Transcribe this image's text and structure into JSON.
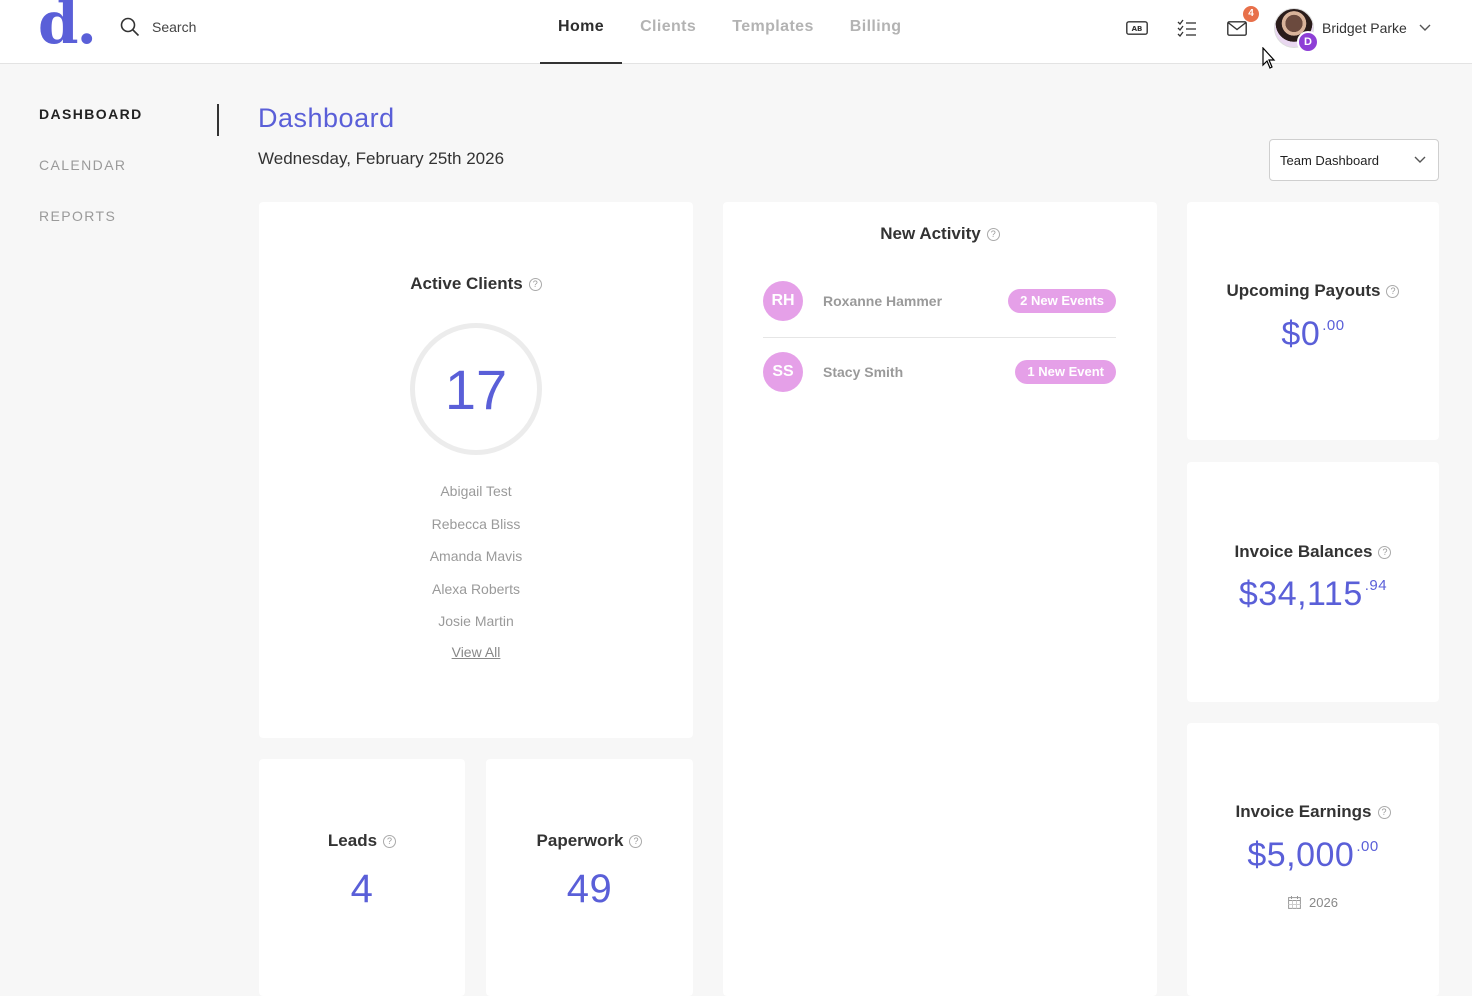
{
  "brand": {
    "logo_letter": "d",
    "logo_dot": "."
  },
  "search": {
    "label": "Search"
  },
  "nav": {
    "home": "Home",
    "clients": "Clients",
    "templates": "Templates",
    "billing": "Billing"
  },
  "header": {
    "mail_badge": "4",
    "user_name": "Bridget Parke",
    "user_avatar_initial": "D",
    "ab_icon_text": "AB"
  },
  "sidebar": {
    "items": [
      "DASHBOARD",
      "CALENDAR",
      "REPORTS"
    ]
  },
  "page": {
    "title": "Dashboard",
    "date": "Wednesday, February 25th 2026",
    "dashboard_select": "Team Dashboard"
  },
  "active_clients": {
    "title": "Active Clients",
    "count": "17",
    "clients": [
      "Abigail Test",
      "Rebecca Bliss",
      "Amanda Mavis",
      "Alexa Roberts",
      "Josie Martin"
    ],
    "view_all": "View All"
  },
  "new_activity": {
    "title": "New Activity",
    "rows": [
      {
        "initials": "RH",
        "name": "Roxanne Hammer",
        "events": "2 New Events"
      },
      {
        "initials": "SS",
        "name": "Stacy Smith",
        "events": "1 New Event"
      }
    ]
  },
  "leads": {
    "title": "Leads",
    "value": "4"
  },
  "paperwork": {
    "title": "Paperwork",
    "value": "49"
  },
  "upcoming_payouts": {
    "title": "Upcoming Payouts",
    "whole": "$0",
    "cents": ".00"
  },
  "invoice_balances": {
    "title": "Invoice Balances",
    "whole": "$34,115",
    "cents": ".94"
  },
  "invoice_earnings": {
    "title": "Invoice Earnings",
    "whole": "$5,000",
    "cents": ".00",
    "year": "2026"
  },
  "colors": {
    "accent": "#5a5fd8",
    "pill": "#e5a0e8",
    "badge": "#e8704a"
  }
}
